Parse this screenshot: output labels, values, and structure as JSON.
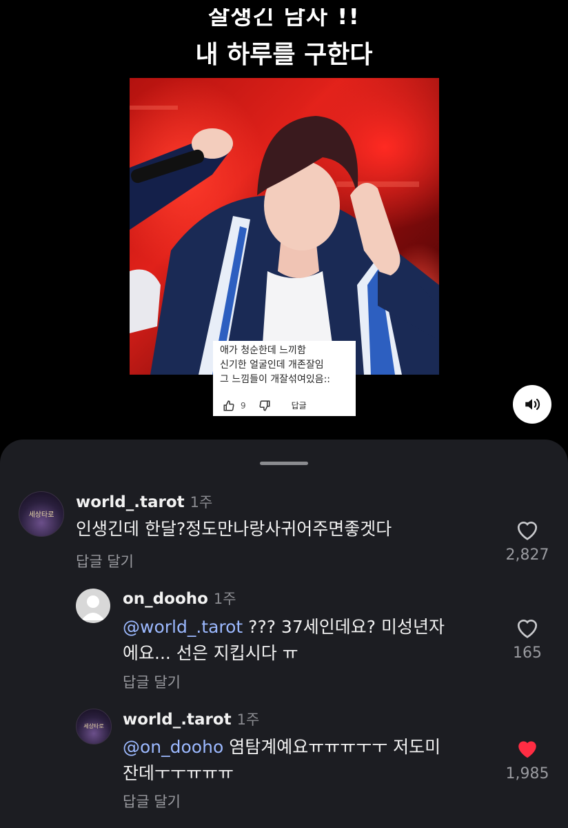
{
  "video": {
    "title_line1": "잘생긴 남사 !!",
    "title_line2": "내 하루를 구한다",
    "embedded_comment": {
      "lines": [
        "애가 청순한데 느끼함",
        "신기한 얼굴인데 개존잘임",
        "그 느낌들이 개잘섞여있음::"
      ],
      "like_count": "9",
      "reply_label": "답글"
    },
    "sound_icon": "speaker-icon"
  },
  "comments": [
    {
      "username": "world_.tarot",
      "time": "1주",
      "avatar_text": "세상타로",
      "text": "인생긴데 한달?정도만나랑사귀어주면좋겟다",
      "reply_label": "답글 달기",
      "likes": "2,827",
      "liked": false
    },
    {
      "username": "on_dooho",
      "time": "1주",
      "mention": "@world_.tarot",
      "text_line1": " ??? 37세인데요? 미성년자",
      "text_line2": "에요... 선은 지킵시다 ㅠ",
      "reply_label": "답글 달기",
      "likes": "165",
      "liked": false
    },
    {
      "username": "world_.tarot",
      "time": "1주",
      "avatar_text": "세상타로",
      "mention": "@on_dooho",
      "text_line1": " 염탐계예요ㅠㅠㅠㅜㅜ 저도미",
      "text_line2": "잔데ㅜㅜㅠㅠㅠ",
      "reply_label": "답글 달기",
      "likes": "1,985",
      "liked": true
    }
  ],
  "colors": {
    "heart_liked": "#ff2d43",
    "mention": "#9cb9ff",
    "sheet_bg": "#1c1d22"
  }
}
